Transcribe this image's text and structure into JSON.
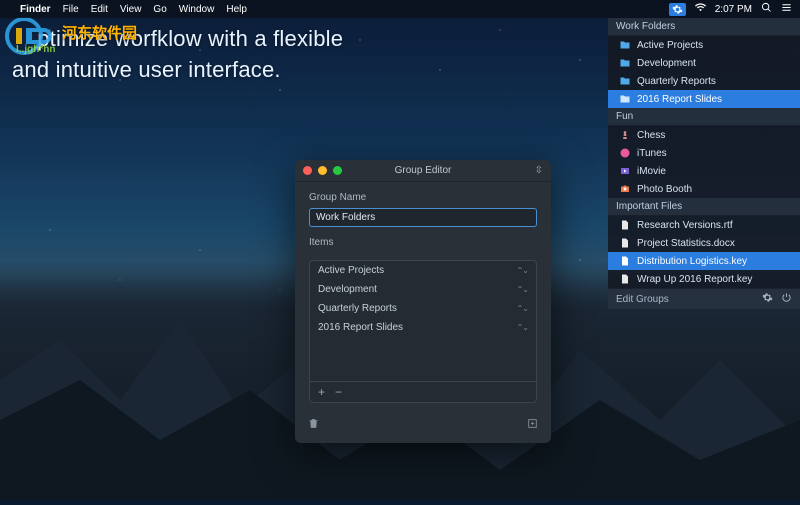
{
  "menubar": {
    "app": "Finder",
    "menus": [
      "File",
      "Edit",
      "View",
      "Go",
      "Window",
      "Help"
    ],
    "clock": "2:07 PM"
  },
  "hero": {
    "line1": "ptimize worfklow with a flexible",
    "line2": "and intuitive user interface."
  },
  "watermark": {
    "brand": "河东软件园",
    "url": "I..jgh*hn"
  },
  "sidepanel": {
    "groups": [
      {
        "title": "Work Folders",
        "items": [
          {
            "label": "Active Projects",
            "icon": "folder",
            "selected": false
          },
          {
            "label": "Development",
            "icon": "folder",
            "selected": false
          },
          {
            "label": "Quarterly Reports",
            "icon": "folder",
            "selected": false
          },
          {
            "label": "2016 Report Slides",
            "icon": "folder",
            "selected": true
          }
        ]
      },
      {
        "title": "Fun",
        "items": [
          {
            "label": "Chess",
            "icon": "chess",
            "selected": false
          },
          {
            "label": "iTunes",
            "icon": "itunes",
            "selected": false
          },
          {
            "label": "iMovie",
            "icon": "imovie",
            "selected": false
          },
          {
            "label": "Photo Booth",
            "icon": "photobooth",
            "selected": false
          }
        ]
      },
      {
        "title": "Important Files",
        "items": [
          {
            "label": "Research Versions.rtf",
            "icon": "file",
            "selected": false
          },
          {
            "label": "Project Statistics.docx",
            "icon": "file",
            "selected": false
          },
          {
            "label": "Distribution Logistics.key",
            "icon": "file",
            "selected": true
          },
          {
            "label": "Wrap Up 2016 Report.key",
            "icon": "file",
            "selected": false
          }
        ]
      }
    ],
    "footer_label": "Edit Groups"
  },
  "editor": {
    "title": "Group Editor",
    "group_name_label": "Group Name",
    "group_name_value": "Work Folders",
    "items_label": "Items",
    "items": [
      "Active Projects",
      "Development",
      "Quarterly Reports",
      "2016 Report Slides"
    ]
  }
}
